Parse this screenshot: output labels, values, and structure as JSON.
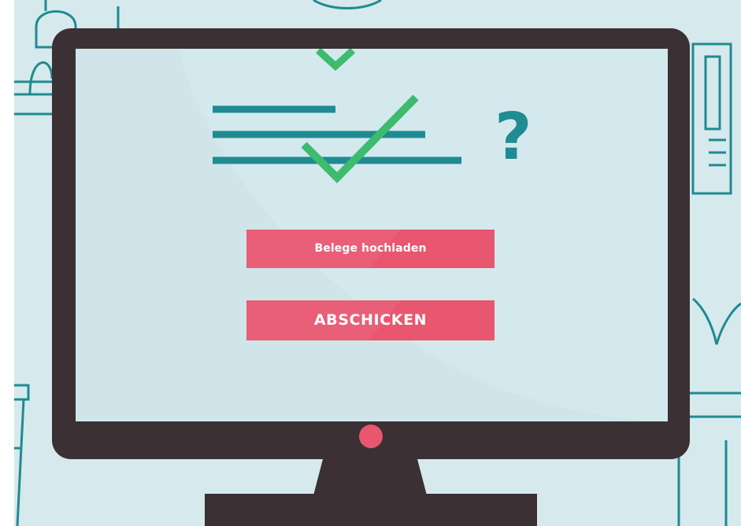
{
  "buttons": {
    "upload_label": "Belege hochladen",
    "submit_label": "ABSCHICKEN"
  },
  "illustration": {
    "question_mark": "?"
  },
  "colors": {
    "background": "#d6e9ec",
    "screen": "#cfe5ea",
    "monitor": "#3b3034",
    "teal": "#1f8b92",
    "checkmark": "#3dbb6e",
    "accent_pink": "#e8566f"
  },
  "icons": [
    "checkmark-icon",
    "question-mark-icon",
    "power-led"
  ]
}
